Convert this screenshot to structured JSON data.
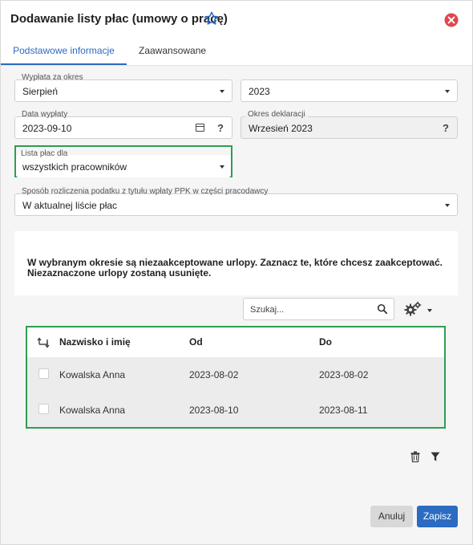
{
  "dialog": {
    "title": "Dodawanie listy płac (umowy o pracę)"
  },
  "tabs": [
    {
      "label": "Podstawowe informacje",
      "active": true
    },
    {
      "label": "Zaawansowane",
      "active": false
    }
  ],
  "form": {
    "period": {
      "label": "Wypłata za okres",
      "month": "Sierpień",
      "year": "2023"
    },
    "payout_date": {
      "label": "Data wypłaty",
      "value": "2023-09-10",
      "help": "?"
    },
    "declaration_period": {
      "label": "Okres deklaracji",
      "value": "Wrzesień 2023",
      "help": "?"
    },
    "payroll_for": {
      "label": "Lista płac dla",
      "value": "wszystkich pracowników"
    },
    "ppk_method": {
      "label": "Sposób rozliczenia podatku z tytułu wpłaty PPK w części pracodawcy",
      "value": "W aktualnej liście płac"
    }
  },
  "notice": "W wybranym okresie są niezaakceptowane urlopy. Zaznacz te, które chcesz zaakceptować. Niezaznaczone urlopy zostaną usunięte.",
  "search": {
    "placeholder": "Szukaj..."
  },
  "table": {
    "columns": [
      "Nazwisko i imię",
      "Od",
      "Do"
    ],
    "rows": [
      {
        "name": "Kowalska Anna",
        "from": "2023-08-02",
        "to": "2023-08-02",
        "checked": false
      },
      {
        "name": "Kowalska Anna",
        "from": "2023-08-10",
        "to": "2023-08-11",
        "checked": false
      }
    ]
  },
  "buttons": {
    "cancel": "Anuluj",
    "save": "Zapisz"
  },
  "colors": {
    "accent": "#2b6bc1",
    "highlight": "#2e9e4f",
    "close": "#e0474c"
  }
}
